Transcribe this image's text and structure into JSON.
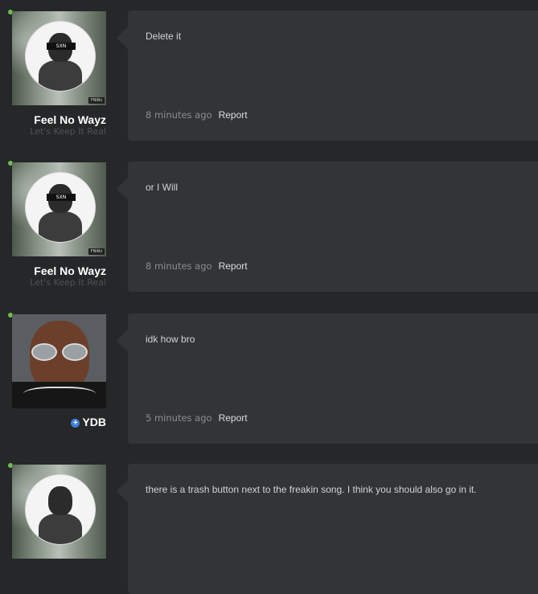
{
  "posts": [
    {
      "username": "Feel No Wayz",
      "user_title": "Let's Keep It Real",
      "avatar_tag": "FNWz",
      "avatar_bar": "SXN",
      "message": "Delete it",
      "time": "8 minutes ago",
      "report_label": "Report"
    },
    {
      "username": "Feel No Wayz",
      "user_title": "Let's Keep It Real",
      "avatar_tag": "FNWz",
      "avatar_bar": "SXN",
      "message": "or I Will",
      "time": "8 minutes ago",
      "report_label": "Report"
    },
    {
      "username": "YDB",
      "message": "idk how bro",
      "time": "5 minutes ago",
      "report_label": "Report"
    },
    {
      "message": "there is a trash button next to the freakin song. I think you should also go in it."
    }
  ],
  "colors": {
    "background": "#262729",
    "bubble": "#333437",
    "online": "#6cc04a",
    "plus_badge": "#3f7ed6"
  }
}
